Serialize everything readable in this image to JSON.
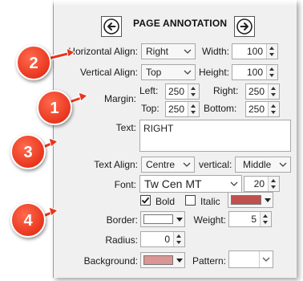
{
  "header": {
    "title": "PAGE ANNOTATION",
    "prev_icon": "arrow-left-circle-icon",
    "next_icon": "arrow-right-circle-icon"
  },
  "fields": {
    "horizontal_align": {
      "label": "Horizontal Align:",
      "value": "Right"
    },
    "width": {
      "label": "Width:",
      "value": "100"
    },
    "vertical_align": {
      "label": "Vertical Align:",
      "value": "Top"
    },
    "height": {
      "label": "Height:",
      "value": "100"
    },
    "margin": {
      "label": "Margin:",
      "left_label": "Left:",
      "left": "250",
      "right_label": "Right:",
      "right": "250",
      "top_label": "Top:",
      "top": "250",
      "bottom_label": "Bottom:",
      "bottom": "250"
    },
    "text": {
      "label": "Text:",
      "value": "RIGHT"
    },
    "text_align": {
      "label": "Text Align:",
      "value": "Centre"
    },
    "vertical": {
      "label": "vertical:",
      "value": "Middle"
    },
    "font": {
      "label": "Font:",
      "value": "Tw Cen MT",
      "size": "20"
    },
    "bold": {
      "label": "Bold",
      "checked": true
    },
    "italic": {
      "label": "Italic",
      "checked": false
    },
    "font_color": "#c0504d",
    "border": {
      "label": "Border:",
      "color": "#ffffff"
    },
    "weight": {
      "label": "Weight:",
      "value": "5"
    },
    "radius": {
      "label": "Radius:",
      "value": "0"
    },
    "background": {
      "label": "Background:",
      "color": "#d99694"
    },
    "pattern": {
      "label": "Pattern:"
    }
  },
  "callouts": [
    "2",
    "1",
    "3",
    "4"
  ],
  "colors": {
    "badge": "#e8361e",
    "panel": "#f0f0f0"
  }
}
